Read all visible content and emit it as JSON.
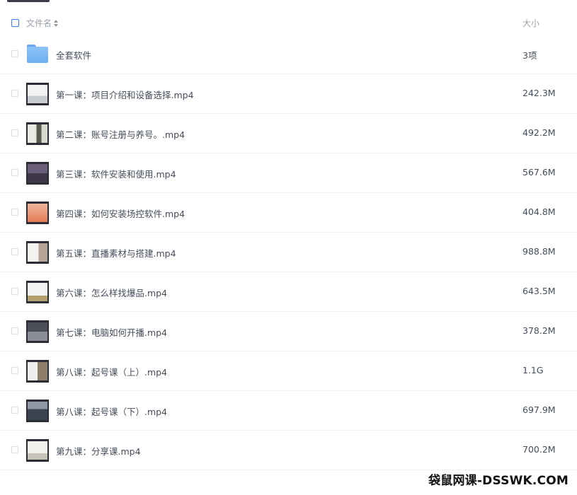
{
  "header": {
    "name_label": "文件名",
    "size_label": "大小"
  },
  "files": [
    {
      "name": "全套软件",
      "size": "3项",
      "kind": "folder"
    },
    {
      "name": "第一课：项目介绍和设备选择.mp4",
      "size": "242.3M",
      "kind": "video"
    },
    {
      "name": "第二课：账号注册与养号。.mp4",
      "size": "492.2M",
      "kind": "video"
    },
    {
      "name": "第三课：软件安装和使用.mp4",
      "size": "567.6M",
      "kind": "video"
    },
    {
      "name": "第四课：如何安装场控软件.mp4",
      "size": "404.8M",
      "kind": "video"
    },
    {
      "name": "第五课：直播素材与搭建.mp4",
      "size": "988.8M",
      "kind": "video"
    },
    {
      "name": "第六课：怎么样找爆品.mp4",
      "size": "643.5M",
      "kind": "video"
    },
    {
      "name": "第七课：电脑如何开播.mp4",
      "size": "378.2M",
      "kind": "video"
    },
    {
      "name": "第八课：起号课（上）.mp4",
      "size": "1.1G",
      "kind": "video"
    },
    {
      "name": "第八课：起号课（下）.mp4",
      "size": "697.9M",
      "kind": "video"
    },
    {
      "name": "第九课：分享课.mp4",
      "size": "700.2M",
      "kind": "video"
    }
  ],
  "watermark": "袋鼠网课-DSSWK.COM",
  "colors": {
    "accent": "#3b7cf0",
    "folder": "#7ab8f4",
    "text": "#454d5a",
    "muted": "#9aa2ad"
  }
}
